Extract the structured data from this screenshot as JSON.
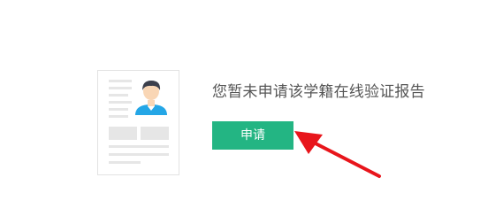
{
  "message": "您暂未申请该学籍在线验证报告",
  "apply_button": {
    "label": "申请"
  },
  "colors": {
    "accent": "#23b583",
    "arrow": "#e8151b",
    "text": "#555555",
    "illustration_lines": "#e6e6e6",
    "avatar_shirt": "#24a6e6",
    "avatar_hair": "#3b3f4c",
    "avatar_skin": "#f9d6b5"
  },
  "icons": {
    "illustration": "resume-document-icon",
    "annotation": "red-arrow-annotation"
  }
}
